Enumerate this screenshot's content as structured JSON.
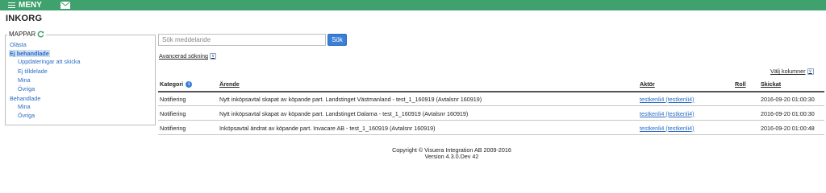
{
  "topbar": {
    "menu_label": "MENY",
    "mail_icon": "envelope-icon",
    "color": "#3fa16e"
  },
  "page_title": "INKORG",
  "folders": {
    "title": "MAPPAR",
    "refresh_icon": "refresh-icon",
    "items": [
      {
        "label": "Olästa"
      },
      {
        "label": "Ej behandlade"
      },
      {
        "label": "Uppdateringar att skicka"
      },
      {
        "label": "Ej tilldelade"
      },
      {
        "label": "Mina"
      },
      {
        "label": "Övriga"
      },
      {
        "label": "Behandlade"
      },
      {
        "label": "Mina"
      },
      {
        "label": "Övriga"
      }
    ]
  },
  "search": {
    "placeholder": "Sök meddelande",
    "value": "",
    "button_label": "Sök"
  },
  "advanced_search_label": "Avancerad sökning",
  "choose_columns_label": "Välj kolumner",
  "table": {
    "headers": {
      "category": "Kategori",
      "subject": "Ärende",
      "actor": "Aktör",
      "role": "Roll",
      "sent": "Skickat"
    },
    "rows": [
      {
        "category": "Notifiering",
        "subject": "Nytt inköpsavtal skapat av köpande part. Landstinget Västmanland - test_1_160919 (Avtalsnr 160919)",
        "actor": "testkenli4 (testkenli4)",
        "role": "",
        "sent": "2016-09-20 01:00:30"
      },
      {
        "category": "Notifiering",
        "subject": "Nytt inköpsavtal skapat av köpande part. Landstinget Dalarna - test_1_160919 (Avtalsnr 160919)",
        "actor": "testkenli4 (testkenli4)",
        "role": "",
        "sent": "2016-09-20 01:00:30"
      },
      {
        "category": "Notifiering",
        "subject": "Inköpsavtal ändrat av köpande part. Invacare AB - test_1_160919 (Avtalsnr 160919)",
        "actor": "testkenli4 (testkenli4)",
        "role": "",
        "sent": "2016-09-20 01:00:48"
      }
    ]
  },
  "footer": {
    "copyright": "Copyright © Visuera Integration AB 2009-2016",
    "version": "Version 4.3.0.Dev 42"
  }
}
